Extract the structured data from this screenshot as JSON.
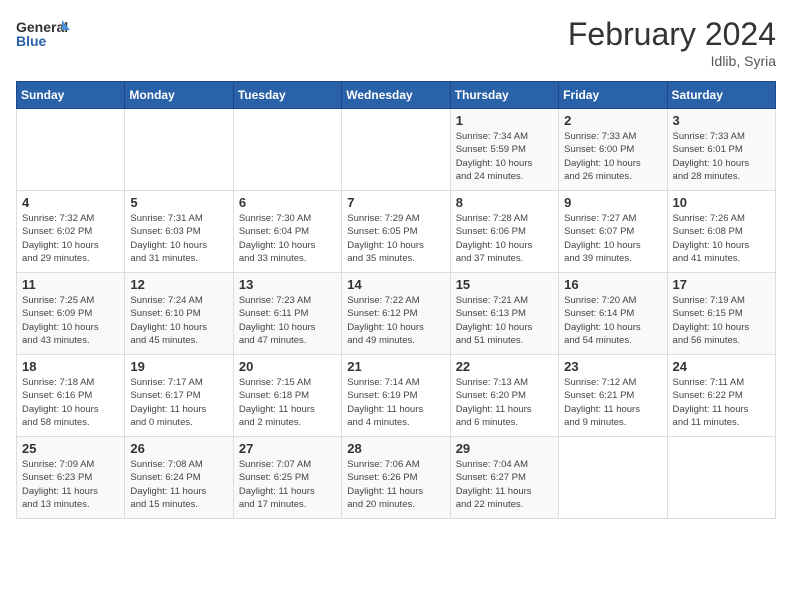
{
  "logo": {
    "line1": "General",
    "line2": "Blue"
  },
  "title": "February 2024",
  "location": "Idlib, Syria",
  "days_of_week": [
    "Sunday",
    "Monday",
    "Tuesday",
    "Wednesday",
    "Thursday",
    "Friday",
    "Saturday"
  ],
  "weeks": [
    [
      {
        "day": "",
        "info": ""
      },
      {
        "day": "",
        "info": ""
      },
      {
        "day": "",
        "info": ""
      },
      {
        "day": "",
        "info": ""
      },
      {
        "day": "1",
        "info": "Sunrise: 7:34 AM\nSunset: 5:59 PM\nDaylight: 10 hours\nand 24 minutes."
      },
      {
        "day": "2",
        "info": "Sunrise: 7:33 AM\nSunset: 6:00 PM\nDaylight: 10 hours\nand 26 minutes."
      },
      {
        "day": "3",
        "info": "Sunrise: 7:33 AM\nSunset: 6:01 PM\nDaylight: 10 hours\nand 28 minutes."
      }
    ],
    [
      {
        "day": "4",
        "info": "Sunrise: 7:32 AM\nSunset: 6:02 PM\nDaylight: 10 hours\nand 29 minutes."
      },
      {
        "day": "5",
        "info": "Sunrise: 7:31 AM\nSunset: 6:03 PM\nDaylight: 10 hours\nand 31 minutes."
      },
      {
        "day": "6",
        "info": "Sunrise: 7:30 AM\nSunset: 6:04 PM\nDaylight: 10 hours\nand 33 minutes."
      },
      {
        "day": "7",
        "info": "Sunrise: 7:29 AM\nSunset: 6:05 PM\nDaylight: 10 hours\nand 35 minutes."
      },
      {
        "day": "8",
        "info": "Sunrise: 7:28 AM\nSunset: 6:06 PM\nDaylight: 10 hours\nand 37 minutes."
      },
      {
        "day": "9",
        "info": "Sunrise: 7:27 AM\nSunset: 6:07 PM\nDaylight: 10 hours\nand 39 minutes."
      },
      {
        "day": "10",
        "info": "Sunrise: 7:26 AM\nSunset: 6:08 PM\nDaylight: 10 hours\nand 41 minutes."
      }
    ],
    [
      {
        "day": "11",
        "info": "Sunrise: 7:25 AM\nSunset: 6:09 PM\nDaylight: 10 hours\nand 43 minutes."
      },
      {
        "day": "12",
        "info": "Sunrise: 7:24 AM\nSunset: 6:10 PM\nDaylight: 10 hours\nand 45 minutes."
      },
      {
        "day": "13",
        "info": "Sunrise: 7:23 AM\nSunset: 6:11 PM\nDaylight: 10 hours\nand 47 minutes."
      },
      {
        "day": "14",
        "info": "Sunrise: 7:22 AM\nSunset: 6:12 PM\nDaylight: 10 hours\nand 49 minutes."
      },
      {
        "day": "15",
        "info": "Sunrise: 7:21 AM\nSunset: 6:13 PM\nDaylight: 10 hours\nand 51 minutes."
      },
      {
        "day": "16",
        "info": "Sunrise: 7:20 AM\nSunset: 6:14 PM\nDaylight: 10 hours\nand 54 minutes."
      },
      {
        "day": "17",
        "info": "Sunrise: 7:19 AM\nSunset: 6:15 PM\nDaylight: 10 hours\nand 56 minutes."
      }
    ],
    [
      {
        "day": "18",
        "info": "Sunrise: 7:18 AM\nSunset: 6:16 PM\nDaylight: 10 hours\nand 58 minutes."
      },
      {
        "day": "19",
        "info": "Sunrise: 7:17 AM\nSunset: 6:17 PM\nDaylight: 11 hours\nand 0 minutes."
      },
      {
        "day": "20",
        "info": "Sunrise: 7:15 AM\nSunset: 6:18 PM\nDaylight: 11 hours\nand 2 minutes."
      },
      {
        "day": "21",
        "info": "Sunrise: 7:14 AM\nSunset: 6:19 PM\nDaylight: 11 hours\nand 4 minutes."
      },
      {
        "day": "22",
        "info": "Sunrise: 7:13 AM\nSunset: 6:20 PM\nDaylight: 11 hours\nand 6 minutes."
      },
      {
        "day": "23",
        "info": "Sunrise: 7:12 AM\nSunset: 6:21 PM\nDaylight: 11 hours\nand 9 minutes."
      },
      {
        "day": "24",
        "info": "Sunrise: 7:11 AM\nSunset: 6:22 PM\nDaylight: 11 hours\nand 11 minutes."
      }
    ],
    [
      {
        "day": "25",
        "info": "Sunrise: 7:09 AM\nSunset: 6:23 PM\nDaylight: 11 hours\nand 13 minutes."
      },
      {
        "day": "26",
        "info": "Sunrise: 7:08 AM\nSunset: 6:24 PM\nDaylight: 11 hours\nand 15 minutes."
      },
      {
        "day": "27",
        "info": "Sunrise: 7:07 AM\nSunset: 6:25 PM\nDaylight: 11 hours\nand 17 minutes."
      },
      {
        "day": "28",
        "info": "Sunrise: 7:06 AM\nSunset: 6:26 PM\nDaylight: 11 hours\nand 20 minutes."
      },
      {
        "day": "29",
        "info": "Sunrise: 7:04 AM\nSunset: 6:27 PM\nDaylight: 11 hours\nand 22 minutes."
      },
      {
        "day": "",
        "info": ""
      },
      {
        "day": "",
        "info": ""
      }
    ]
  ]
}
